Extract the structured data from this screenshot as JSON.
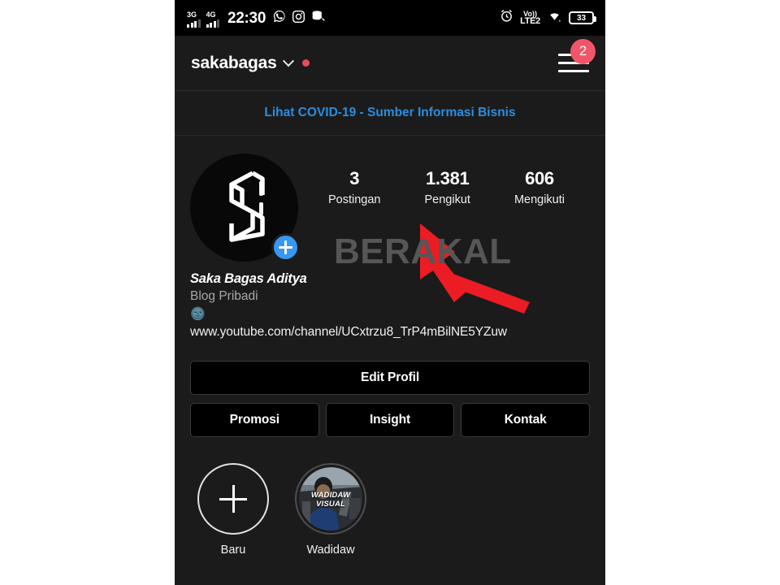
{
  "status_bar": {
    "network_1": "3G",
    "network_2": "4G",
    "time": "22:30",
    "icons": [
      "whatsapp-icon",
      "instagram-icon",
      "data-saver-off-icon",
      "alarm-icon",
      "wifi-icon"
    ],
    "volte_line1": "Vo))",
    "volte_line2": "LTE2",
    "battery_level": "33"
  },
  "header": {
    "username": "sakabagas",
    "chevron": "chevron-down-icon",
    "status_dot": "red-dot-indicator",
    "menu_icon": "hamburger-menu-icon",
    "menu_badge": "2"
  },
  "banner": {
    "text": "Lihat COVID-19 - Sumber Informasi Bisnis"
  },
  "profile": {
    "avatar_alt": "saka-logo-avatar",
    "add_story_label": "+",
    "stats": [
      {
        "value": "3",
        "label": "Postingan"
      },
      {
        "value": "1.381",
        "label": "Pengikut"
      },
      {
        "value": "606",
        "label": "Mengikuti"
      }
    ],
    "bio_name": "Saka Bagas Aditya",
    "bio_category": "Blog Pribadi",
    "bio_emoji": "🌚",
    "bio_link": "www.youtube.com/channel/UCxtrzu8_TrP4mBilNE5YZuw"
  },
  "watermark": "BERAKAL",
  "actions": {
    "edit_profile": "Edit Profil",
    "promosi": "Promosi",
    "insight": "Insight",
    "kontak": "Kontak"
  },
  "highlights": [
    {
      "label": "Baru",
      "type": "new"
    },
    {
      "label": "Wadidaw",
      "type": "photo",
      "overlay_text": "WADIDAW VISUAL"
    }
  ],
  "annotation": {
    "arrow_color": "#ec1c24",
    "arrow_target": "Edit Profil"
  },
  "colors": {
    "background": "#1b1b1b",
    "status_bar": "#000000",
    "link_blue": "#2d8ddd",
    "accent_blue": "#3897f0",
    "badge_red": "#f2556a",
    "watermark_gray": "#565656"
  }
}
